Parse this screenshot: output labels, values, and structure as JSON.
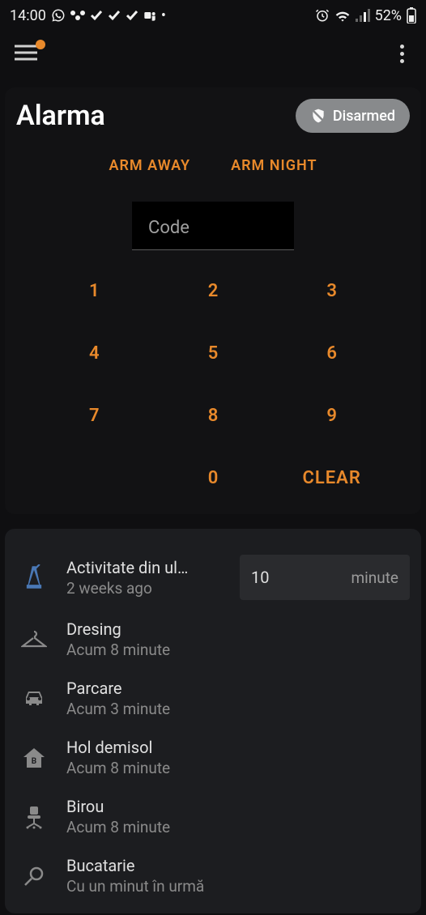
{
  "statusbar": {
    "time": "14:00",
    "battery": "52%"
  },
  "alarm": {
    "title": "Alarma",
    "badge": "Disarmed",
    "arm_away": "ARM AWAY",
    "arm_night": "ARM NIGHT",
    "code_placeholder": "Code",
    "keys": {
      "k1": "1",
      "k2": "2",
      "k3": "3",
      "k4": "4",
      "k5": "5",
      "k6": "6",
      "k7": "7",
      "k8": "8",
      "k9": "9",
      "k0": "0",
      "clear": "CLEAR"
    }
  },
  "activity": {
    "input_value": "10",
    "input_unit": "minute"
  },
  "sensors": [
    {
      "title": "Activitate din ul…",
      "sub": "2 weeks ago"
    },
    {
      "title": "Dresing",
      "sub": "Acum 8 minute"
    },
    {
      "title": "Parcare",
      "sub": "Acum 3 minute"
    },
    {
      "title": "Hol demisol",
      "sub": "Acum 8 minute"
    },
    {
      "title": "Birou",
      "sub": "Acum 8 minute"
    },
    {
      "title": "Bucatarie",
      "sub": "Cu un minut în urmă"
    }
  ]
}
